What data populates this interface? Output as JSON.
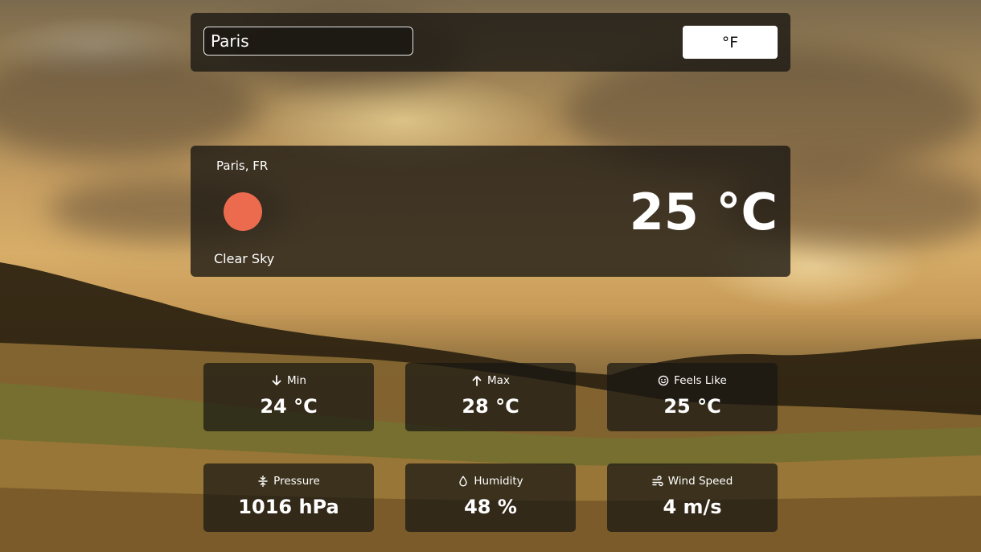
{
  "search": {
    "value": "Paris",
    "unit_toggle_label": "°F"
  },
  "current": {
    "location": "Paris, FR",
    "description": "Clear Sky",
    "temperature": "25 °C",
    "icon": "sun-icon",
    "icon_color": "#ec6b4f"
  },
  "stats": {
    "min": {
      "label": "Min",
      "value": "24 °C",
      "icon": "arrow-down-icon"
    },
    "max": {
      "label": "Max",
      "value": "28 °C",
      "icon": "arrow-up-icon"
    },
    "feels_like": {
      "label": "Feels Like",
      "value": "25 °C",
      "icon": "smile-icon"
    },
    "pressure": {
      "label": "Pressure",
      "value": "1016 hPa",
      "icon": "compress-icon"
    },
    "humidity": {
      "label": "Humidity",
      "value": "48 %",
      "icon": "droplet-icon"
    },
    "wind_speed": {
      "label": "Wind Speed",
      "value": "4 m/s",
      "icon": "wind-icon"
    }
  }
}
